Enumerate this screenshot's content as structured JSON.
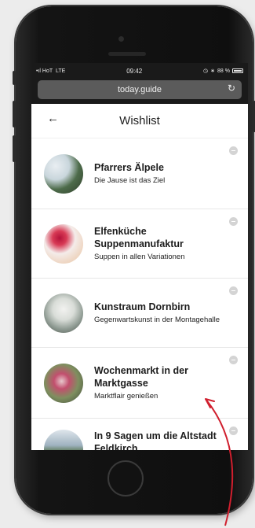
{
  "statusbar": {
    "carrier": "HoT",
    "network": "LTE",
    "time": "09:42",
    "battery": "88 %"
  },
  "browser": {
    "url": "today.guide"
  },
  "page": {
    "title": "Wishlist"
  },
  "wishlist": [
    {
      "title": "Pfarrers Älpele",
      "subtitle": "Die Jause ist das Ziel"
    },
    {
      "title": "Elfenküche Suppenmanufaktur",
      "subtitle": "Suppen in allen Variationen"
    },
    {
      "title": "Kunstraum Dornbirn",
      "subtitle": "Gegenwartskunst in der Montagehalle"
    },
    {
      "title": "Wochenmarkt in der Marktgasse",
      "subtitle": "Marktflair genießen"
    },
    {
      "title": "In 9 Sagen um die Altstadt Feldkirch",
      "subtitle": ""
    }
  ],
  "icons": {
    "back": "back-arrow-icon",
    "reload": "reload-icon",
    "remove": "remove-icon"
  },
  "colors": {
    "annotation_arrow": "#d01f2e",
    "remove_button": "#d4d4d4"
  }
}
